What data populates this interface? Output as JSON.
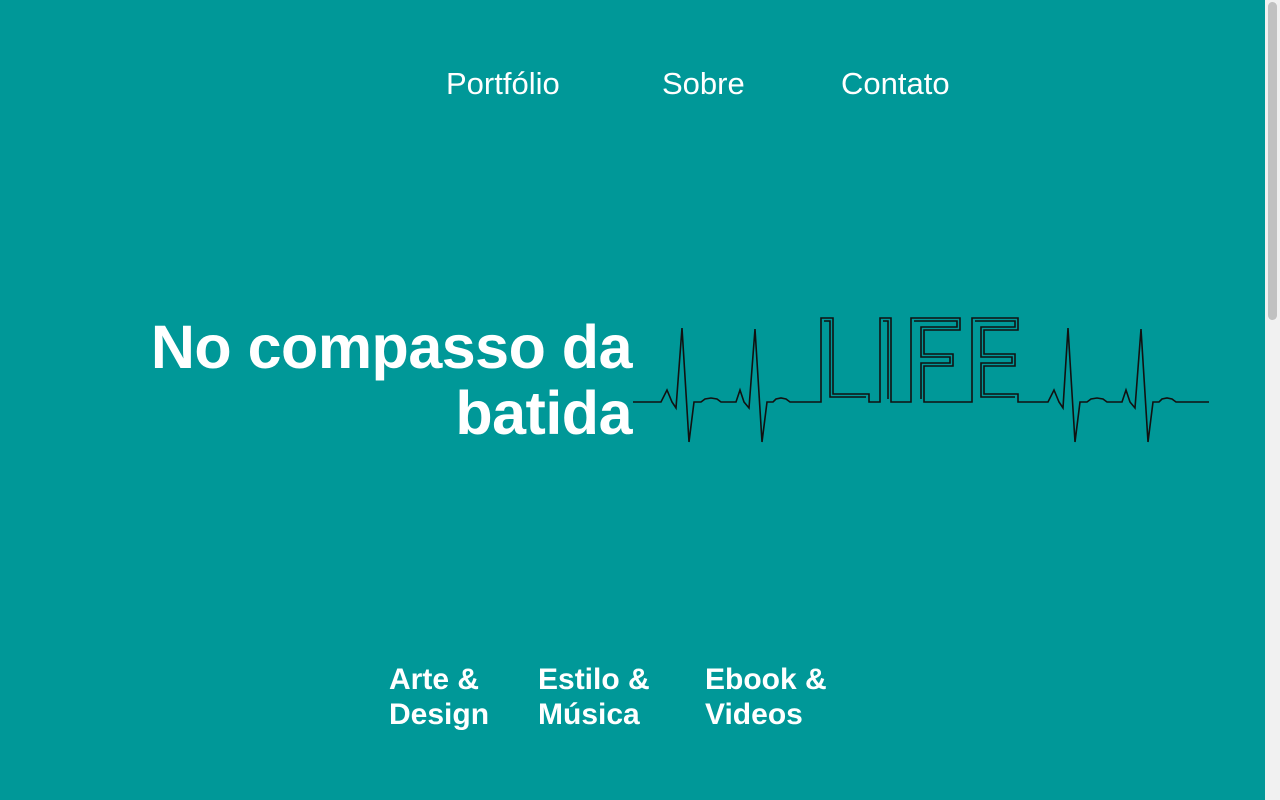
{
  "nav": {
    "items": [
      {
        "label": "Portfólio"
      },
      {
        "label": "Sobre"
      },
      {
        "label": "Contato"
      }
    ]
  },
  "hero": {
    "title_line1": "No compasso da",
    "title_line2": "batida",
    "graphic_text": "LIFE"
  },
  "categories": [
    {
      "line1": "Arte &",
      "line2": "Design"
    },
    {
      "line1": "Estilo &",
      "line2": "Música"
    },
    {
      "line1": "Ebook &",
      "line2": "Videos"
    }
  ],
  "colors": {
    "background": "#009898",
    "text": "#ffffff",
    "line": "#111111"
  }
}
